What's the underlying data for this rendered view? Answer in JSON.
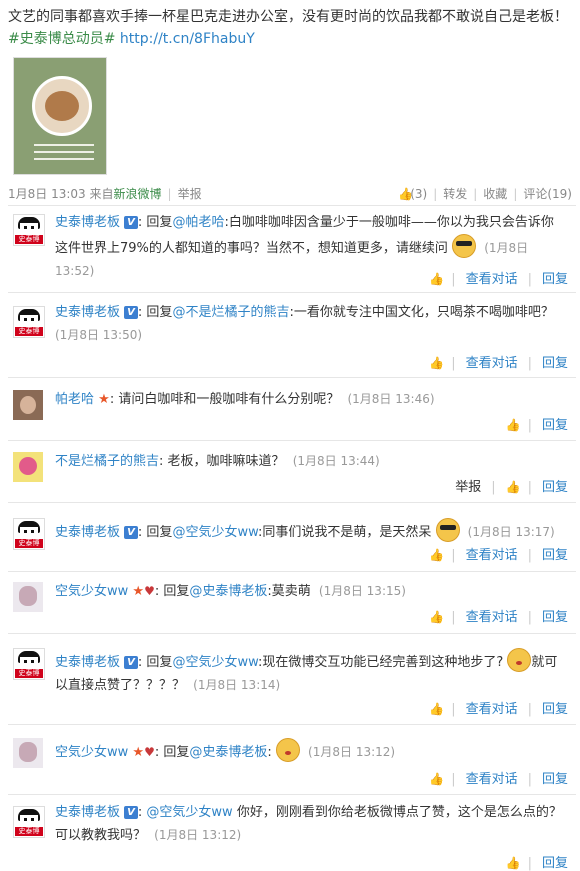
{
  "post": {
    "text_main": "文艺的同事都喜欢手捧一杯星巴克走进办公室，没有更时尚的饮品我都不敢说自己是老板！",
    "hashtag": "#史泰博总动员#",
    "link": "http://t.cn/8FhabuY",
    "time": "1月8日 13:03",
    "source_prefix": "来自",
    "source": "新浪微博",
    "report": "举报",
    "like_count": "(3)",
    "forward": "转发",
    "favorite": "收藏",
    "comments": "评论(19)"
  },
  "actions": {
    "view": "查看对话",
    "reply": "回复",
    "report": "举报"
  },
  "comments": [
    {
      "name": "史泰博老板",
      "reply_prefix": "回复",
      "at": "@帕老哈",
      "text": ":白咖啡咖啡因含量少于一般咖啡——你以为我只会告诉你这件世界上79%的人都知道的事吗？当然不，想知道更多，请继续问",
      "time": "(1月8日 13:52)"
    },
    {
      "name": "史泰博老板",
      "reply_prefix": "回复",
      "at": "@不是烂橘子的熊吉",
      "text": ":一看你就专注中国文化，只喝茶不喝咖啡吧？",
      "time": "(1月8日 13:50)"
    },
    {
      "name": "帕老哈",
      "text": "请问白咖啡和一般咖啡有什么分别呢？",
      "time": "(1月8日 13:46)"
    },
    {
      "name": "不是烂橘子的熊吉",
      "text": "老板，咖啡嘛味道？",
      "time": "(1月8日 13:44)"
    },
    {
      "name": "史泰博老板",
      "reply_prefix": "回复",
      "at": "@空気少女ww",
      "text": ":同事们说我不是萌，是天然呆",
      "time": "(1月8日 13:17)"
    },
    {
      "name": "空気少女ww",
      "reply_prefix": "回复",
      "at": "@史泰博老板",
      "text": ":莫卖萌",
      "time": "(1月8日 13:15)"
    },
    {
      "name": "史泰博老板",
      "reply_prefix": "回复",
      "at": "@空気少女ww",
      "text": ":现在微博交互功能已经完善到这种地步了?",
      "text2": "就可以直接点赞了？？？？",
      "time": "(1月8日 13:14)"
    },
    {
      "name": "空気少女ww",
      "reply_prefix": "回复",
      "at": "@史泰博老板",
      "text": ":",
      "time": "(1月8日 13:12)"
    },
    {
      "name": "史泰博老板",
      "at": "@空気少女ww",
      "text": " 你好，刚刚看到你给老板微博点了赞，这个是怎么点的？可以教教我吗？",
      "time": "(1月8日 13:12)"
    }
  ],
  "avatar_tag": "史泰博",
  "colors": {
    "link": "#2f83c6",
    "green": "#3a8b48",
    "vbadge": "#3c7fd1"
  },
  "icons": [
    "like-icon",
    "verified-badge",
    "star-icon",
    "cool-emoji",
    "kiss-emoji"
  ]
}
